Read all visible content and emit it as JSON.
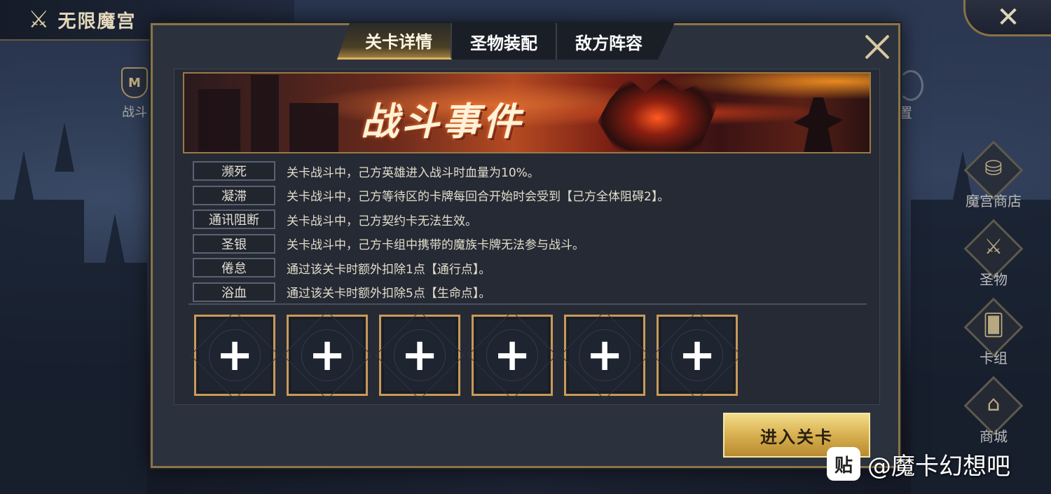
{
  "header": {
    "title": "无限魔宫",
    "battle_label": "战斗",
    "config_label": "置"
  },
  "side_menu": [
    {
      "label": "魔宫商店",
      "icon": "treasure-icon"
    },
    {
      "label": "圣物",
      "icon": "sword-icon"
    },
    {
      "label": "卡组",
      "icon": "cards-icon"
    },
    {
      "label": "商城",
      "icon": "chest-icon"
    }
  ],
  "dialog": {
    "tabs": [
      {
        "label": "关卡详情",
        "active": true
      },
      {
        "label": "圣物装配",
        "active": false
      },
      {
        "label": "敌方阵容",
        "active": false
      }
    ],
    "banner_text": "战斗事件",
    "events": [
      {
        "tag": "濒死",
        "desc": "关卡战斗中，己方英雄进入战斗时血量为10%。"
      },
      {
        "tag": "凝滞",
        "desc": "关卡战斗中，己方等待区的卡牌每回合开始时会受到【己方全体阻碍2】。"
      },
      {
        "tag": "通讯阻断",
        "desc": "关卡战斗中，己方契约卡无法生效。"
      },
      {
        "tag": "圣银",
        "desc": "关卡战斗中，己方卡组中携带的魔族卡牌无法参与战斗。"
      },
      {
        "tag": "倦怠",
        "desc": "通过该关卡时额外扣除1点【通行点】。"
      },
      {
        "tag": "浴血",
        "desc": "通过该关卡时额外扣除5点【生命点】。"
      }
    ],
    "slots": [
      "+",
      "+",
      "+",
      "+",
      "+",
      "+"
    ],
    "enter_button": "进入关卡"
  },
  "watermark": {
    "logo": "贴",
    "text": "@魔卡幻想吧"
  },
  "colors": {
    "accent_gold": "#c89a5a",
    "panel_bg": "#2c323d",
    "button_gold": "#d8b050"
  }
}
